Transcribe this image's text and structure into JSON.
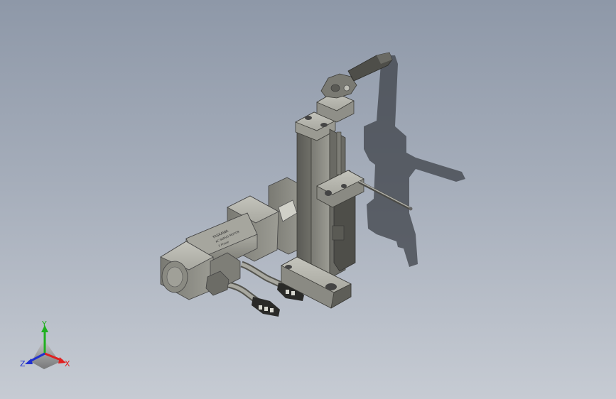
{
  "viewport": {
    "background_top": "#8e98a8",
    "background_bottom": "#c6cbd3"
  },
  "model": {
    "part_color": "#8f8f88",
    "part_dark": "#5e5e58",
    "part_light": "#b8b8b0",
    "shadow_color": "#3e4148",
    "motor_label_line1": "YASKAWA",
    "motor_label_line2": "AC SERVO MOTOR",
    "motor_label_line3": "3 Phase"
  },
  "triad": {
    "x_label": "X",
    "y_label": "Y",
    "z_label": "Z",
    "x_color": "#e02020",
    "y_color": "#20b020",
    "z_color": "#2030d0"
  }
}
